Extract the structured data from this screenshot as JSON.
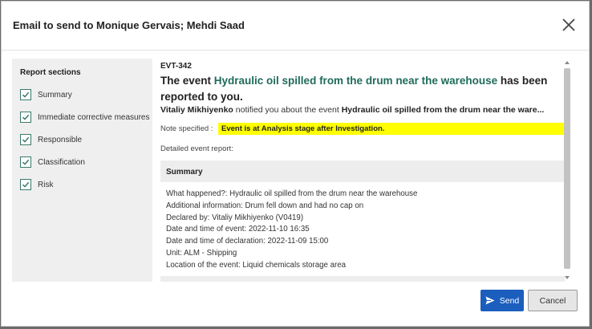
{
  "dialog": {
    "title": "Email to send to Monique Gervais; Mehdi Saad"
  },
  "sidebar": {
    "title": "Report sections",
    "items": [
      {
        "label": "Summary",
        "checked": true
      },
      {
        "label": "Immediate corrective measures",
        "checked": true
      },
      {
        "label": "Responsible",
        "checked": true
      },
      {
        "label": "Classification",
        "checked": true
      },
      {
        "label": "Risk",
        "checked": true
      }
    ]
  },
  "content": {
    "event_id": "EVT-342",
    "heading_prefix": "The event ",
    "heading_link": "Hydraulic oil spilled from the drum near the warehouse",
    "heading_suffix": " has been reported to you.",
    "notifier": "Vitaliy Mikhiyenko",
    "notify_text": " notified you about the event ",
    "notify_event": "Hydraulic oil spilled from the drum near the ware...",
    "note_label": "Note specified :",
    "note_value": "Event is at Analysis stage after Investigation.",
    "detail_label": "Detailed event report:",
    "summary_title": "Summary",
    "summary_lines": [
      "What happened?: Hydraulic oil spilled from the drum near the warehouse",
      "Additional information: Drum fell down and had no cap on",
      "Declared by: Vitaliy Mikhiyenko (V0419)",
      "Date and time of event: 2022-11-10 16:35",
      "Date and time of declaration: 2022-11-09 15:00",
      "Unit: ALM - Shipping",
      "Location of the event: Liquid chemicals storage area"
    ]
  },
  "footer": {
    "send_label": "Send",
    "cancel_label": "Cancel"
  },
  "colors": {
    "accent": "#1b5ebe",
    "link": "#1f6b5a",
    "highlight": "#ffff00",
    "checkbox": "#3b7a6a"
  }
}
